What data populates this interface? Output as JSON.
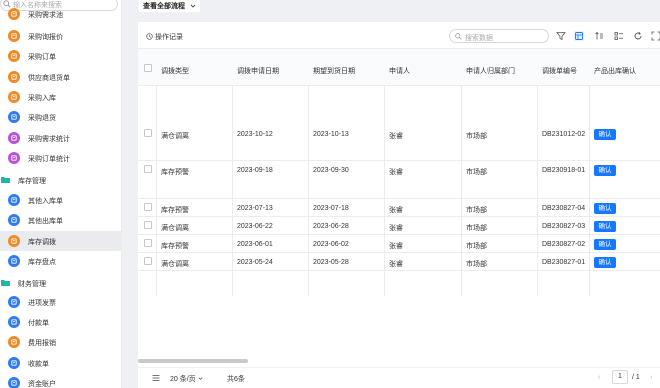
{
  "sidebar": {
    "search_placeholder": "输入名称来搜索",
    "top_cut_label": "采购需求池",
    "items_a": [
      {
        "label": "采购询报价",
        "color": "#f08a24"
      },
      {
        "label": "采购订单",
        "color": "#f08a24"
      },
      {
        "label": "供应商退货单",
        "color": "#f08a24"
      },
      {
        "label": "采购入库",
        "color": "#f08a24"
      },
      {
        "label": "采购退货",
        "color": "#2f7bf5"
      },
      {
        "label": "采购需求统计",
        "color": "#b654d6"
      },
      {
        "label": "采购订单统计",
        "color": "#b654d6"
      }
    ],
    "group_inventory": "库存管理",
    "items_b": [
      {
        "label": "其他入库单",
        "color": "#2f7bf5",
        "active": false
      },
      {
        "label": "其他出库单",
        "color": "#2f7bf5",
        "active": false
      },
      {
        "label": "库存调拨",
        "color": "#f08a24",
        "active": true
      },
      {
        "label": "库存盘点",
        "color": "#2f7bf5",
        "active": false
      }
    ],
    "group_finance": "财务管理",
    "items_c": [
      {
        "label": "进项发票",
        "color": "#2f7bf5"
      },
      {
        "label": "付款单",
        "color": "#2f7bf5"
      },
      {
        "label": "费用报销",
        "color": "#f08a24"
      },
      {
        "label": "收款单",
        "color": "#2f7bf5"
      },
      {
        "label": "资金账户",
        "color": "#2f7bf5"
      }
    ]
  },
  "header": {
    "view_label": "查看全部流程"
  },
  "toolbar": {
    "oplog_label": "操作记录",
    "search_placeholder": "搜索数据",
    "icons": [
      "filter-icon",
      "table-view-icon",
      "sort-icon",
      "group-icon",
      "refresh-icon",
      "fullscreen-icon"
    ]
  },
  "table": {
    "headers": [
      "调拨类型",
      "调拨申请日期",
      "期望到货日期",
      "申请人",
      "申请人归属部门",
      "调拨单编号",
      "产品出库确认"
    ],
    "rows": [
      {
        "type": "满仓调离",
        "apply_date": "2023-10-12",
        "expect_date": "2023-10-13",
        "applicant": "张睿",
        "dept": "市场部",
        "code": "DB231012-02",
        "action": "确认"
      },
      {
        "type": "库存预警",
        "apply_date": "2023-09-18",
        "expect_date": "2023-09-30",
        "applicant": "张睿",
        "dept": "市场部",
        "code": "DB230918-01",
        "action": "确认"
      },
      {
        "type": "库存预警",
        "apply_date": "2023-07-13",
        "expect_date": "2023-07-18",
        "applicant": "张睿",
        "dept": "市场部",
        "code": "DB230827-04",
        "action": "确认"
      },
      {
        "type": "满仓调离",
        "apply_date": "2023-06-22",
        "expect_date": "2023-06-28",
        "applicant": "张睿",
        "dept": "市场部",
        "code": "DB230827-03",
        "action": "确认"
      },
      {
        "type": "库存预警",
        "apply_date": "2023-06-01",
        "expect_date": "2023-06-02",
        "applicant": "张睿",
        "dept": "市场部",
        "code": "DB230827-02",
        "action": "确认"
      },
      {
        "type": "满仓调离",
        "apply_date": "2023-05-24",
        "expect_date": "2023-05-28",
        "applicant": "张睿",
        "dept": "市场部",
        "code": "DB230827-01",
        "action": "确认"
      }
    ]
  },
  "footer": {
    "page_size": "20 条/页",
    "total": "共6条",
    "prev": "‹",
    "current_page": "1",
    "page_of": "/ 1",
    "next": "›"
  },
  "colors": {
    "accent": "#1677ff",
    "orange": "#f08a24",
    "blue": "#2f7bf5",
    "purple": "#b654d6",
    "folder": "#1fb8a8"
  }
}
